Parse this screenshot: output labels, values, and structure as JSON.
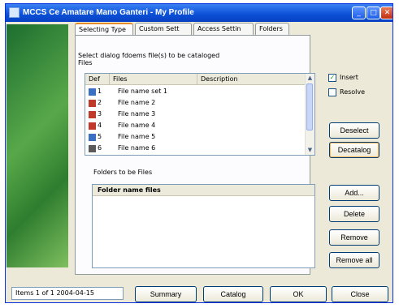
{
  "window": {
    "title": "MCCS Ce Amatare Mano Ganteri - My Profile",
    "min_glyph": "_",
    "max_glyph": "□",
    "close_glyph": "✕"
  },
  "tabs": [
    {
      "label": "Selecting Type"
    },
    {
      "label": "Custom Sett"
    },
    {
      "label": "Access Settin"
    },
    {
      "label": "Folders"
    }
  ],
  "selection_label": "Select dialog fdoems file(s) to be cataloged",
  "files_group": {
    "label": "Files",
    "columns": [
      "Def",
      "Files",
      "Description"
    ],
    "rows": [
      {
        "def": "1",
        "file": "File name set 1",
        "icon_color": "#3a6fc4"
      },
      {
        "def": "2",
        "file": "File name 2",
        "icon_color": "#c0392b"
      },
      {
        "def": "3",
        "file": "File name 3",
        "icon_color": "#c0392b"
      },
      {
        "def": "4",
        "file": "File name 4",
        "icon_color": "#c0392b"
      },
      {
        "def": "5",
        "file": "File name 5",
        "icon_color": "#3a6fc4"
      },
      {
        "def": "6",
        "file": "File name 6",
        "icon_color": "#5a5a5a"
      }
    ]
  },
  "checkbox_1": {
    "label": "Insert",
    "checked": "✓"
  },
  "checkbox_2": {
    "label": "Resolve"
  },
  "buttons": {
    "deselect": "Deselect",
    "decatalog": "Decatalog",
    "add": "Add...",
    "delete": "Delete",
    "remove": "Remove",
    "remove_all": "Remove all",
    "summary": "Summary",
    "catalog": "Catalog",
    "ok": "OK",
    "close": "Close"
  },
  "folders_group": {
    "label": "Folders to be Files",
    "column": "Folder name files"
  },
  "status_text": "Items 1 of 1 2004-04-15"
}
